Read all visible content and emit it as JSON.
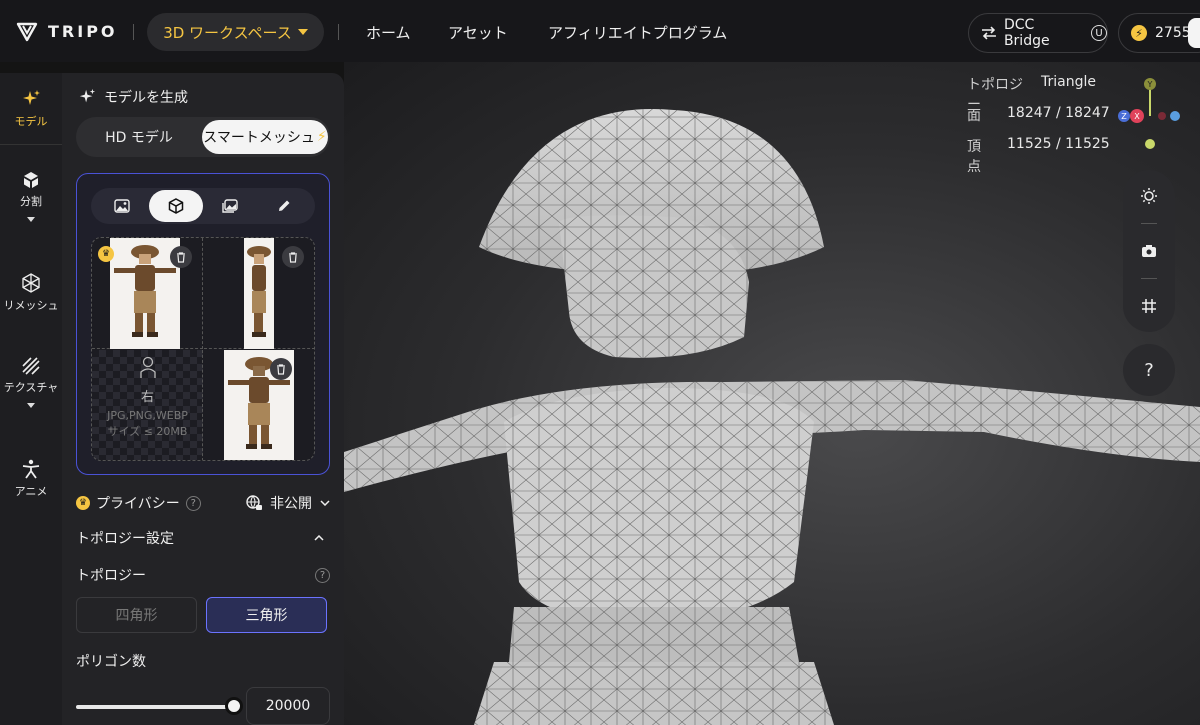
{
  "app": {
    "brand": "TRIPO"
  },
  "header": {
    "workspace_label": "3D ワークスペース",
    "nav": [
      "ホーム",
      "アセット",
      "アフィリエイトプログラム"
    ],
    "dcc_label": "DCC Bridge",
    "dcc_badge": "U",
    "credits": "2755"
  },
  "rail": {
    "items": [
      {
        "label": "モデル",
        "icon": "sparkle-icon"
      },
      {
        "label": "分割",
        "icon": "cube-split-icon"
      },
      {
        "label": "リメッシュ",
        "icon": "mesh-icon"
      },
      {
        "label": "テクスチャ",
        "icon": "texture-icon"
      },
      {
        "label": "アニメ",
        "icon": "person-icon"
      }
    ]
  },
  "panel": {
    "title": "モデルを生成",
    "mode_hd": "HD モデル",
    "mode_smart": "スマートメッシュ",
    "upload": {
      "right_label": "右",
      "hint": "JPG,PNG,WEBP サイズ ≤ 20MB"
    },
    "privacy_label": "プライバシー",
    "privacy_value": "非公開",
    "topology_section": "トポロジー設定",
    "topology_label": "トポロジー",
    "topology_quad": "四角形",
    "topology_tri": "三角形",
    "polycount_label": "ポリゴン数",
    "polycount_value": "20000",
    "polycount_fraction": 0.95
  },
  "viewport": {
    "stats": {
      "topology_key": "トポロジー",
      "topology_val": "Triangle",
      "faces_key": "面",
      "faces_val": "18247 / 18247",
      "verts_key": "頂点",
      "verts_val": "11525 / 11525"
    },
    "gizmo": {
      "y": "Y",
      "z": "Z",
      "x": "X"
    },
    "help": "?"
  },
  "colors": {
    "accent": "#f5c542",
    "selection": "#6b73ff"
  }
}
